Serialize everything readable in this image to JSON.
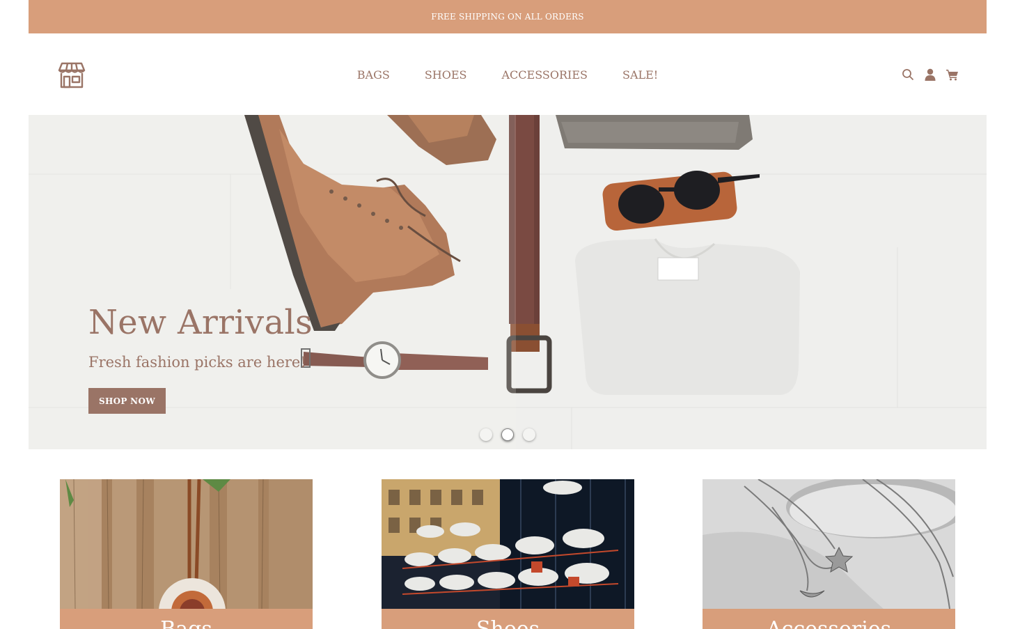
{
  "announcement": {
    "text": "FREE SHIPPING ON ALL ORDERS"
  },
  "header": {
    "logo_icon": "storefront-icon",
    "nav": [
      {
        "label": "BAGS"
      },
      {
        "label": "SHOES"
      },
      {
        "label": "ACCESSORIES"
      },
      {
        "label": "SALE!"
      }
    ],
    "icons": [
      "search-icon",
      "user-icon",
      "cart-icon"
    ]
  },
  "hero": {
    "title": "New Arrivals",
    "subtitle": "Fresh fashion picks are here!",
    "button_label": "SHOP NOW",
    "slides": 3,
    "active_slide": 2
  },
  "categories": [
    {
      "label": "Bags"
    },
    {
      "label": "Shoes"
    },
    {
      "label": "Accessories"
    }
  ],
  "colors": {
    "accent": "#d89e7b",
    "brand_text": "#9a7466",
    "background": "#ffffff"
  }
}
